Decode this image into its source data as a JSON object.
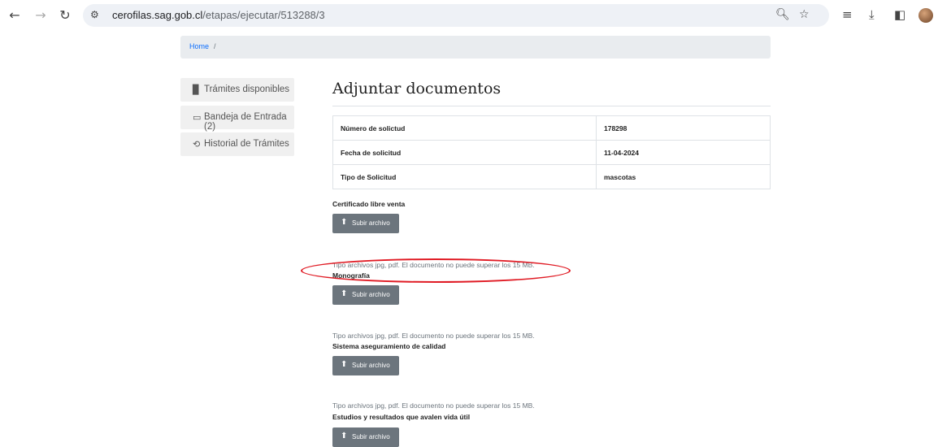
{
  "browser": {
    "url_host": "cerofilas.sag.gob.cl",
    "url_path": "/etapas/ejecutar/513288/3",
    "icons": [
      "back-arrow-icon",
      "forward-arrow-icon",
      "reload-icon",
      "site-settings-icon",
      "zoom-icon",
      "bookmark-star-icon",
      "reading-list-icon",
      "download-icon",
      "side-panel-icon",
      "profile-avatar"
    ]
  },
  "breadcrumb": {
    "home": "Home",
    "separator": "/"
  },
  "sidebar": {
    "items": [
      {
        "label": "Trámites disponibles",
        "icon": "file-icon"
      },
      {
        "label": "Bandeja de Entrada (2)",
        "icon": "inbox-icon"
      },
      {
        "label": "Historial de Trámites",
        "icon": "history-icon"
      }
    ]
  },
  "main": {
    "title": "Adjuntar documentos",
    "info": [
      {
        "label": "Número de solictud",
        "value": "178298"
      },
      {
        "label": "Fecha de solicitud",
        "value": "11-04-2024"
      },
      {
        "label": "Tipo de Solicitud",
        "value": "mascotas"
      }
    ],
    "upload_label": "Subir archivo",
    "help_text": "Tipo archivos jpg, pdf. El documento no puede superar los 15 MB.",
    "documents": [
      {
        "label": "Certificado libre venta"
      },
      {
        "label": "Monografía"
      },
      {
        "label": "Sistema aseguramiento de calidad"
      },
      {
        "label": "Estudios y resultados que avalen vida útil"
      }
    ]
  },
  "colors": {
    "annotation": "#e01b24",
    "button": "#6c757d",
    "link": "#0d6efd"
  }
}
